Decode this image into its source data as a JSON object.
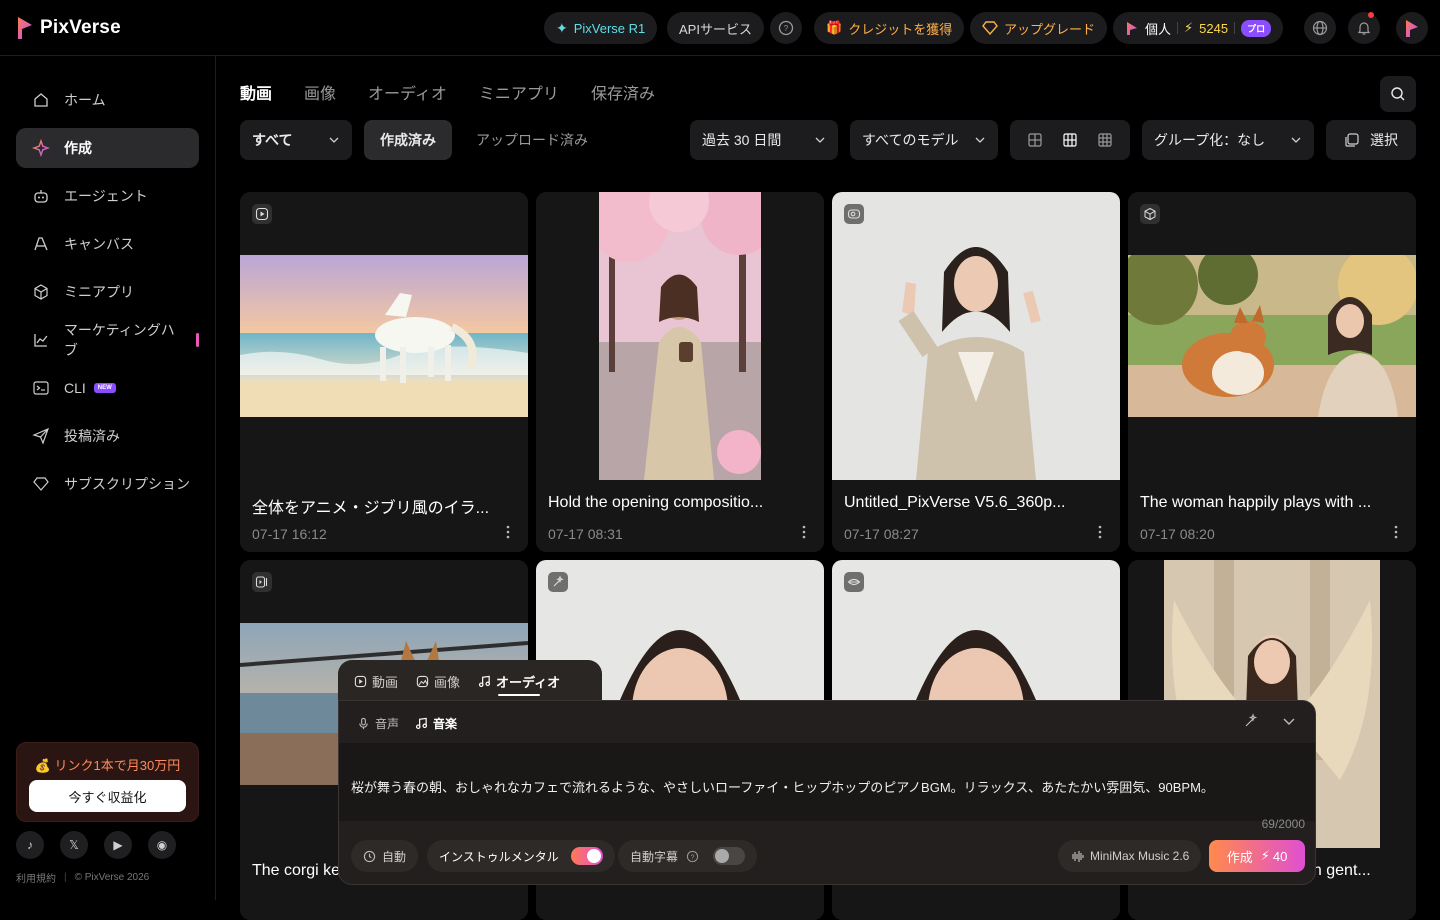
{
  "app": {
    "name": "PixVerse"
  },
  "header": {
    "model_promo": "PixVerse R1",
    "api": "APIサービス",
    "get_credits": "クレジットを獲得",
    "upgrade": "アップグレード",
    "account": "個人",
    "credits": "5245",
    "plan": "プロ"
  },
  "sidebar": {
    "items": [
      {
        "label": "ホーム"
      },
      {
        "label": "作成"
      },
      {
        "label": "エージェント"
      },
      {
        "label": "キャンバス"
      },
      {
        "label": "ミニアプリ"
      },
      {
        "label": "マーケティングハブ"
      },
      {
        "label": "CLI",
        "tag": "NEW"
      },
      {
        "label": "投稿済み"
      },
      {
        "label": "サブスクリプション"
      }
    ],
    "promo_title": "💰 リンク1本で月30万円",
    "promo_button": "今すぐ収益化",
    "terms": "利用規約",
    "copyright": "© PixVerse 2026"
  },
  "tabs": [
    "動画",
    "画像",
    "オーディオ",
    "ミニアプリ",
    "保存済み"
  ],
  "filters": {
    "all": "すべて",
    "created": "作成済み",
    "uploaded": "アップロード済み",
    "period": "過去 30 日間",
    "models": "すべてのモデル",
    "group": "グループ化：なし",
    "select": "選択"
  },
  "cards": [
    {
      "title": "全体をアニメ・ジブリ風のイラ...",
      "date": "07-17  16:12"
    },
    {
      "title": "Hold the opening compositio...",
      "date": "07-17  08:31"
    },
    {
      "title": "Untitled_PixVerse V5.6_360p...",
      "date": "07-17  08:27"
    },
    {
      "title": "The woman happily plays with ...",
      "date": "07-17  08:20"
    },
    {
      "title": "The corgi ke",
      "date": ""
    },
    {
      "title": "",
      "date": ""
    },
    {
      "title": "",
      "date": ""
    },
    {
      "title": "an gent...",
      "date": ""
    }
  ],
  "composer": {
    "tabs": [
      "動画",
      "画像",
      "オーディオ"
    ],
    "subtabs": [
      "音声",
      "音楽"
    ],
    "prompt": "桜が舞う春の朝、おしゃれなカフェで流れるような、やさしいローファイ・ヒップホップのピアノBGM。リラックス、あたたかい雰囲気、90BPM。",
    "count": "69/2000",
    "auto": "自動",
    "instrumental": "インストゥルメンタル",
    "auto_lyrics": "自動字幕",
    "model": "MiniMax Music 2.6",
    "create": "作成",
    "cost": "40"
  }
}
